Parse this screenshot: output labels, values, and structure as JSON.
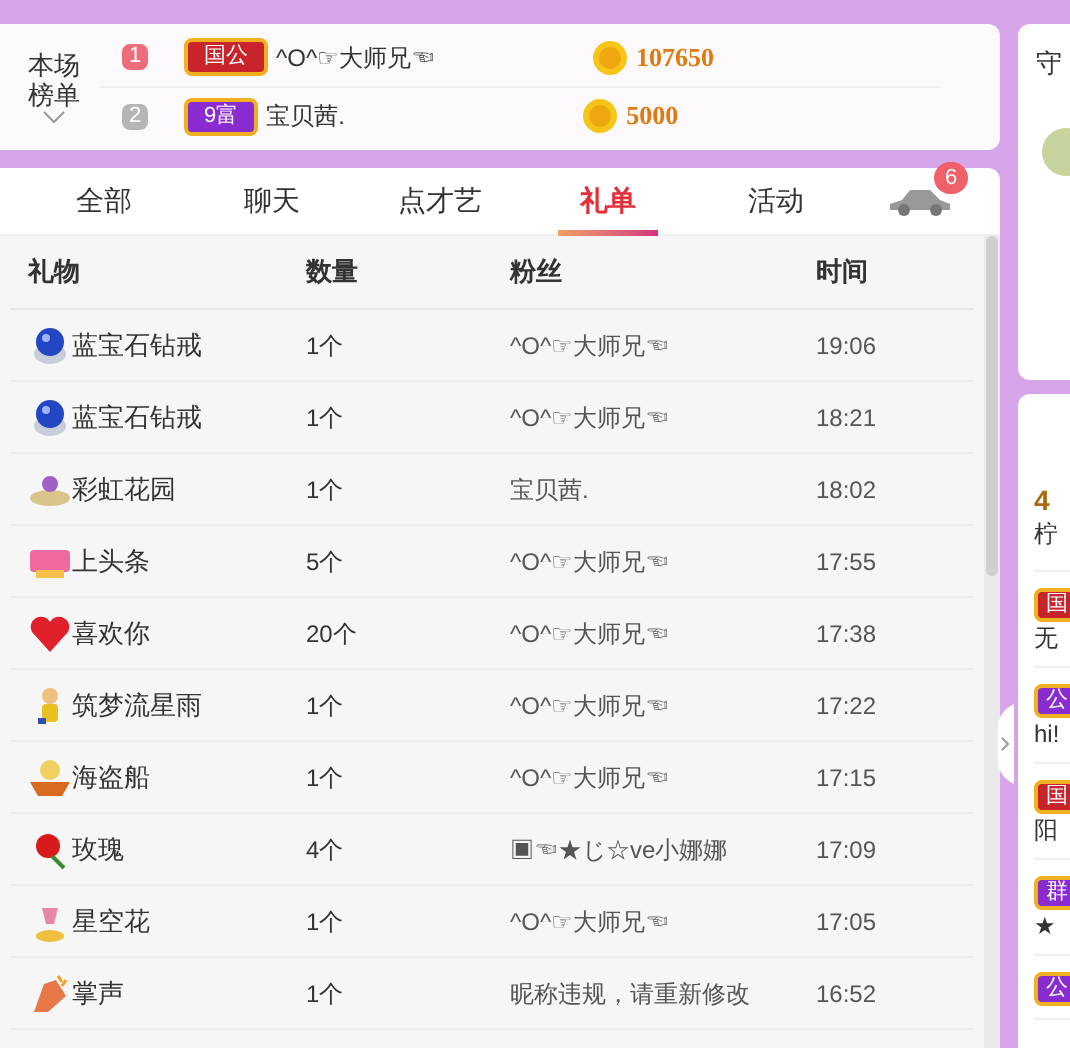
{
  "leaderboard": {
    "title": "本场榜单",
    "entries": [
      {
        "rank": "1",
        "badge": {
          "text": "国公",
          "color": "#c8242c"
        },
        "name": "^O^☞大师兄☜",
        "score": "107650"
      },
      {
        "rank": "2",
        "badge": {
          "text": "9富",
          "color": "#8a2bd0"
        },
        "name": "宝贝茜.",
        "score": "5000"
      }
    ]
  },
  "tabs": [
    {
      "label": "全部",
      "selected": false
    },
    {
      "label": "聊天",
      "selected": false
    },
    {
      "label": "点才艺",
      "selected": false
    },
    {
      "label": "礼单",
      "selected": true
    },
    {
      "label": "活动",
      "selected": false
    }
  ],
  "car_badge": "6",
  "table": {
    "columns": [
      "礼物",
      "数量",
      "粉丝",
      "时间"
    ],
    "rows": [
      {
        "kind": "sapphire",
        "gift": "蓝宝石钻戒",
        "qty": "1个",
        "fan": "^O^☞大师兄☜",
        "time": "19:06"
      },
      {
        "kind": "sapphire",
        "gift": "蓝宝石钻戒",
        "qty": "1个",
        "fan": "^O^☞大师兄☜",
        "time": "18:21"
      },
      {
        "kind": "garden",
        "gift": "彩虹花园",
        "qty": "1个",
        "fan": "宝贝茜.",
        "time": "18:02"
      },
      {
        "kind": "headline",
        "gift": "上头条",
        "qty": "5个",
        "fan": "^O^☞大师兄☜",
        "time": "17:55"
      },
      {
        "kind": "heart",
        "gift": "喜欢你",
        "qty": "20个",
        "fan": "^O^☞大师兄☜",
        "time": "17:38"
      },
      {
        "kind": "doll",
        "gift": "筑梦流星雨",
        "qty": "1个",
        "fan": "^O^☞大师兄☜",
        "time": "17:22"
      },
      {
        "kind": "ship",
        "gift": "海盗船",
        "qty": "1个",
        "fan": "^O^☞大师兄☜",
        "time": "17:15"
      },
      {
        "kind": "rose",
        "gift": "玫瑰",
        "qty": "4个",
        "fan": "▣☜★じ☆ve小娜娜",
        "time": "17:09"
      },
      {
        "kind": "flower",
        "gift": "星空花",
        "qty": "1个",
        "fan": "^O^☞大师兄☜",
        "time": "17:05"
      },
      {
        "kind": "clap",
        "gift": "掌声",
        "qty": "1个",
        "fan": "昵称违规，请重新修改",
        "time": "16:52"
      }
    ]
  },
  "side": {
    "title": "守",
    "first": {
      "count": "4",
      "text": "柠"
    },
    "messages": [
      {
        "badge": {
          "text": "国",
          "color": "#c8242c"
        },
        "text": "无"
      },
      {
        "badge": {
          "text": "公",
          "color": "#8a2bd0"
        },
        "text": "hi!"
      },
      {
        "badge": {
          "text": "国",
          "color": "#c8242c"
        },
        "text": "阳"
      },
      {
        "badge": {
          "text": "群",
          "color": "#8a2bd0"
        },
        "text": "★"
      },
      {
        "badge": {
          "text": "公",
          "color": "#8a2bd0"
        }
      }
    ]
  }
}
